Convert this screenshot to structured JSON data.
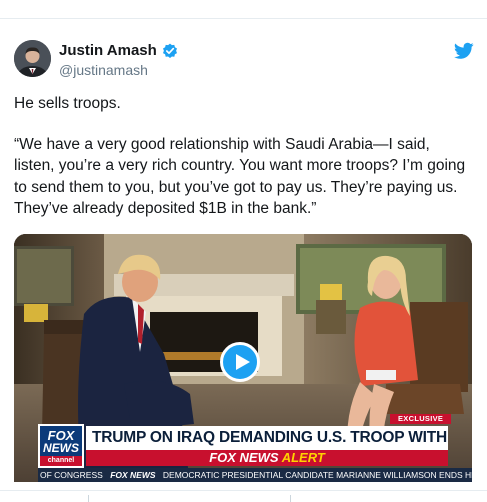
{
  "tweet": {
    "author": {
      "display_name": "Justin Amash",
      "handle": "@justinamash",
      "verified": true,
      "avatar_icon": "profile-avatar"
    },
    "paragraphs": [
      "He sells troops.",
      "“We have a very good relationship with Saudi Arabia—I said, listen, you’re a very rich country. You want more troops? I’m going to send them to you, but you’ve got to pay us. They’re paying us. They’ve already deposited $1B in the bank.”"
    ],
    "brand_icon": "twitter-bird-icon"
  },
  "video": {
    "play_icon": "play-icon",
    "overlay": {
      "badge": "EXCLUSIVE",
      "logo_line1": "FOX",
      "logo_line2": "NEWS",
      "logo_line3": "channel",
      "headline": "TRUMP ON IRAQ DEMANDING U.S. TROOP WITHDRAWAL",
      "alert_brand": "FOX NEWS",
      "alert_word": "ALERT",
      "ticker_left": "OF CONGRESS",
      "ticker_brand": "FOX NEWS",
      "ticker_right": "DEMOCRATIC PRESIDENTIAL CANDIDATE MARIANNE WILLIAMSON ENDS HE"
    }
  },
  "colors": {
    "twitter_blue": "#1da1f2",
    "fox_red": "#c8102e",
    "fox_navy": "#0b3a7a",
    "alert_yellow": "#ffd200"
  }
}
